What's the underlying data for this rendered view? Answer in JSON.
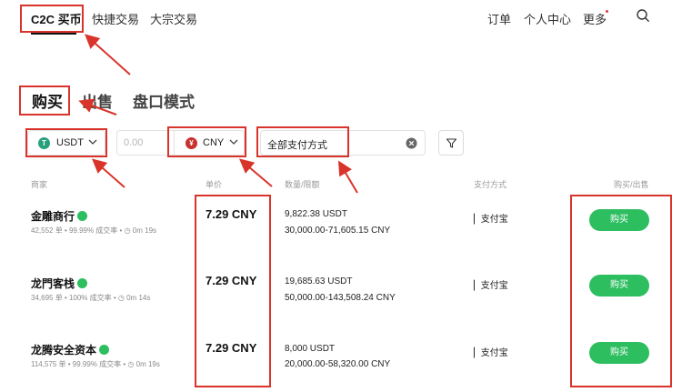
{
  "nav": {
    "items": [
      "C2C 买币",
      "快捷交易",
      "大宗交易"
    ],
    "right": [
      "订单",
      "个人中心",
      "更多"
    ]
  },
  "tabs": [
    "购买",
    "出售",
    "盘口模式"
  ],
  "filters": {
    "coin": "USDT",
    "amount_placeholder": "0.00",
    "fiat": "CNY",
    "payment": "全部支付方式"
  },
  "table": {
    "headers": [
      "商家",
      "单价",
      "数量/限额",
      "支付方式",
      "购买/出售"
    ],
    "rows": [
      {
        "merchant": "金雕商行",
        "stats": [
          "42,552 单",
          "99.99% 成交率",
          "0m 19s"
        ],
        "price": "7.29 CNY",
        "quantity": "9,822.38 USDT",
        "limit": "30,000.00-71,605.15 CNY",
        "payment": "支付宝",
        "action": "购买"
      },
      {
        "merchant": "龙門客栈",
        "stats": [
          "34,695 单",
          "100% 成交率",
          "0m 14s"
        ],
        "price": "7.29 CNY",
        "quantity": "19,685.63 USDT",
        "limit": "50,000.00-143,508.24 CNY",
        "payment": "支付宝",
        "action": "购买"
      },
      {
        "merchant": "龙腾安全资本",
        "stats": [
          "114,575 单",
          "99.99% 成交率",
          "0m 19s"
        ],
        "price": "7.29 CNY",
        "quantity": "8,000 USDT",
        "limit": "20,000.00-58,320.00 CNY",
        "payment": "支付宝",
        "action": "购买"
      }
    ]
  },
  "colors": {
    "green": "#2dbe60",
    "annotation_red": "#d9342b",
    "usdt": "#26a17b",
    "cny": "#c8302e"
  },
  "icons": [
    "search-icon",
    "filter-icon",
    "chevron-down-icon",
    "clear-icon",
    "verified-icon",
    "clock-icon"
  ]
}
